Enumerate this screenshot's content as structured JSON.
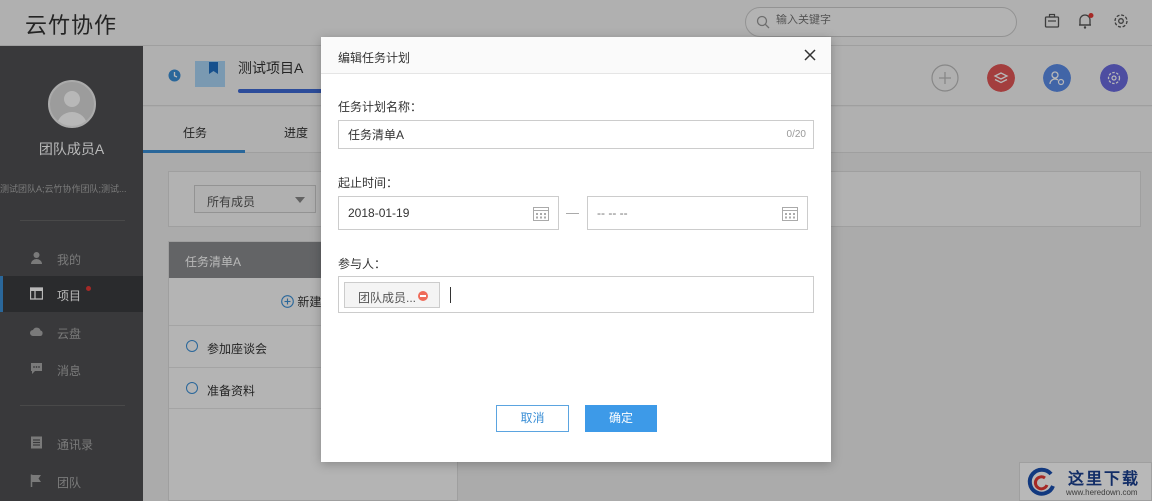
{
  "app": {
    "title": "云竹协作"
  },
  "search": {
    "placeholder": "输入关键字"
  },
  "sidebar": {
    "username": "团队成员A",
    "teams": "测试团队A;云竹协作团队;测试...",
    "items": [
      {
        "label": "我的",
        "icon": "user-icon"
      },
      {
        "label": "项目",
        "icon": "project-icon",
        "active": true,
        "badge": true
      },
      {
        "label": "云盘",
        "icon": "cloud-icon"
      },
      {
        "label": "消息",
        "icon": "message-icon"
      },
      {
        "label": "通讯录",
        "icon": "contacts-icon"
      },
      {
        "label": "团队",
        "icon": "flag-icon"
      }
    ]
  },
  "project": {
    "name": "测试项目A"
  },
  "tabs": [
    {
      "label": "任务"
    },
    {
      "label": "进度"
    }
  ],
  "filter": {
    "member": "所有成员"
  },
  "tasklist": {
    "title": "任务清单A",
    "new_label": "新建",
    "tasks": [
      {
        "label": "参加座谈会"
      },
      {
        "label": "准备资料"
      }
    ]
  },
  "dialog": {
    "title": "编辑任务计划",
    "name_label": "任务计划名称：",
    "name_value": "任务清单A",
    "name_counter": "0/20",
    "date_label": "起止时间：",
    "start_date": "2018-01-19",
    "end_placeholder": "-- -- --",
    "participants_label": "参与人：",
    "participant": "团队成员...",
    "cancel_label": "取消",
    "ok_label": "确定"
  },
  "watermark": {
    "text": "这里下载",
    "url": "www.heredown.com"
  },
  "colors": {
    "accent": "#3d9ae8",
    "sidebar": "#4f5053",
    "danger": "#ef6c5a",
    "red_icon": "#e25656",
    "blue_icon": "#5b8de8",
    "purple_icon": "#6b6be0"
  }
}
